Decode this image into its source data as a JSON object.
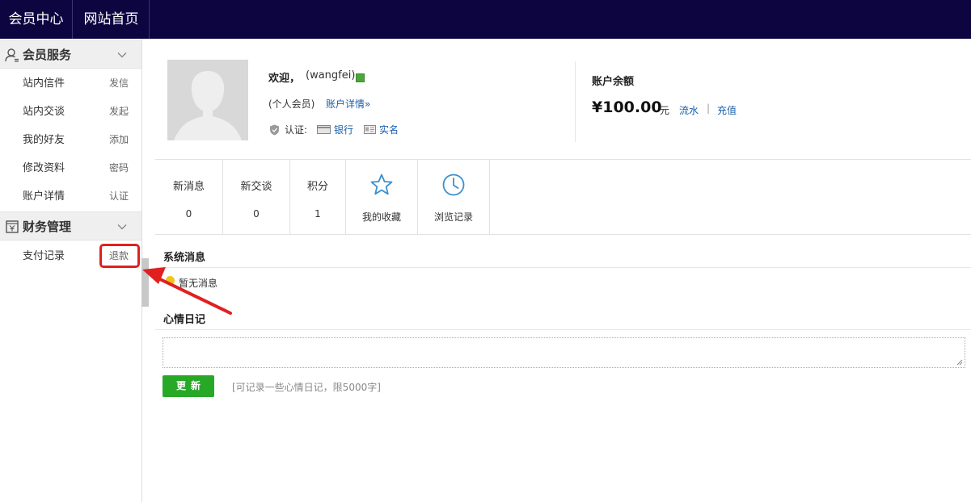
{
  "topnav": {
    "tabs": [
      {
        "label": "会员中心"
      },
      {
        "label": "网站首页"
      }
    ]
  },
  "sidebar": {
    "sections": [
      {
        "title": "会员服务",
        "icon": "user-icon",
        "items": [
          {
            "label": "站内信件",
            "action": "发信"
          },
          {
            "label": "站内交谈",
            "action": "发起"
          },
          {
            "label": "我的好友",
            "action": "添加"
          },
          {
            "label": "修改资料",
            "action": "密码"
          },
          {
            "label": "账户详情",
            "action": "认证"
          }
        ]
      },
      {
        "title": "财务管理",
        "icon": "yen-register-icon",
        "items": [
          {
            "label": "支付记录",
            "action": "退款"
          }
        ]
      }
    ]
  },
  "profile": {
    "welcome": "欢迎，",
    "username": "(wangfei)",
    "role": "(个人会员)",
    "detail_link": "账户详情»",
    "cert_label": "认证:",
    "bank_link": "银行",
    "realname_link": "实名"
  },
  "balance": {
    "title": "账户余额",
    "amount": "¥100.00",
    "unit": "元",
    "flow_link": "流水",
    "separator": "|",
    "recharge_link": "充值"
  },
  "stats": [
    {
      "label": "新消息",
      "value": "0"
    },
    {
      "label": "新交谈",
      "value": "0"
    },
    {
      "label": "积分",
      "value": "1"
    }
  ],
  "shortcuts": [
    {
      "label": "我的收藏",
      "icon": "star-icon"
    },
    {
      "label": "浏览记录",
      "icon": "clock-icon"
    }
  ],
  "system_messages": {
    "title": "系统消息",
    "empty": "暂无消息"
  },
  "mood_diary": {
    "title": "心情日记",
    "button": "更新",
    "hint": "[可记录一些心情日记，限5000字]"
  },
  "colors": {
    "topbar": "#0d0540",
    "link": "#1a5fa8",
    "button": "#27a827",
    "highlight": "#e02020"
  }
}
